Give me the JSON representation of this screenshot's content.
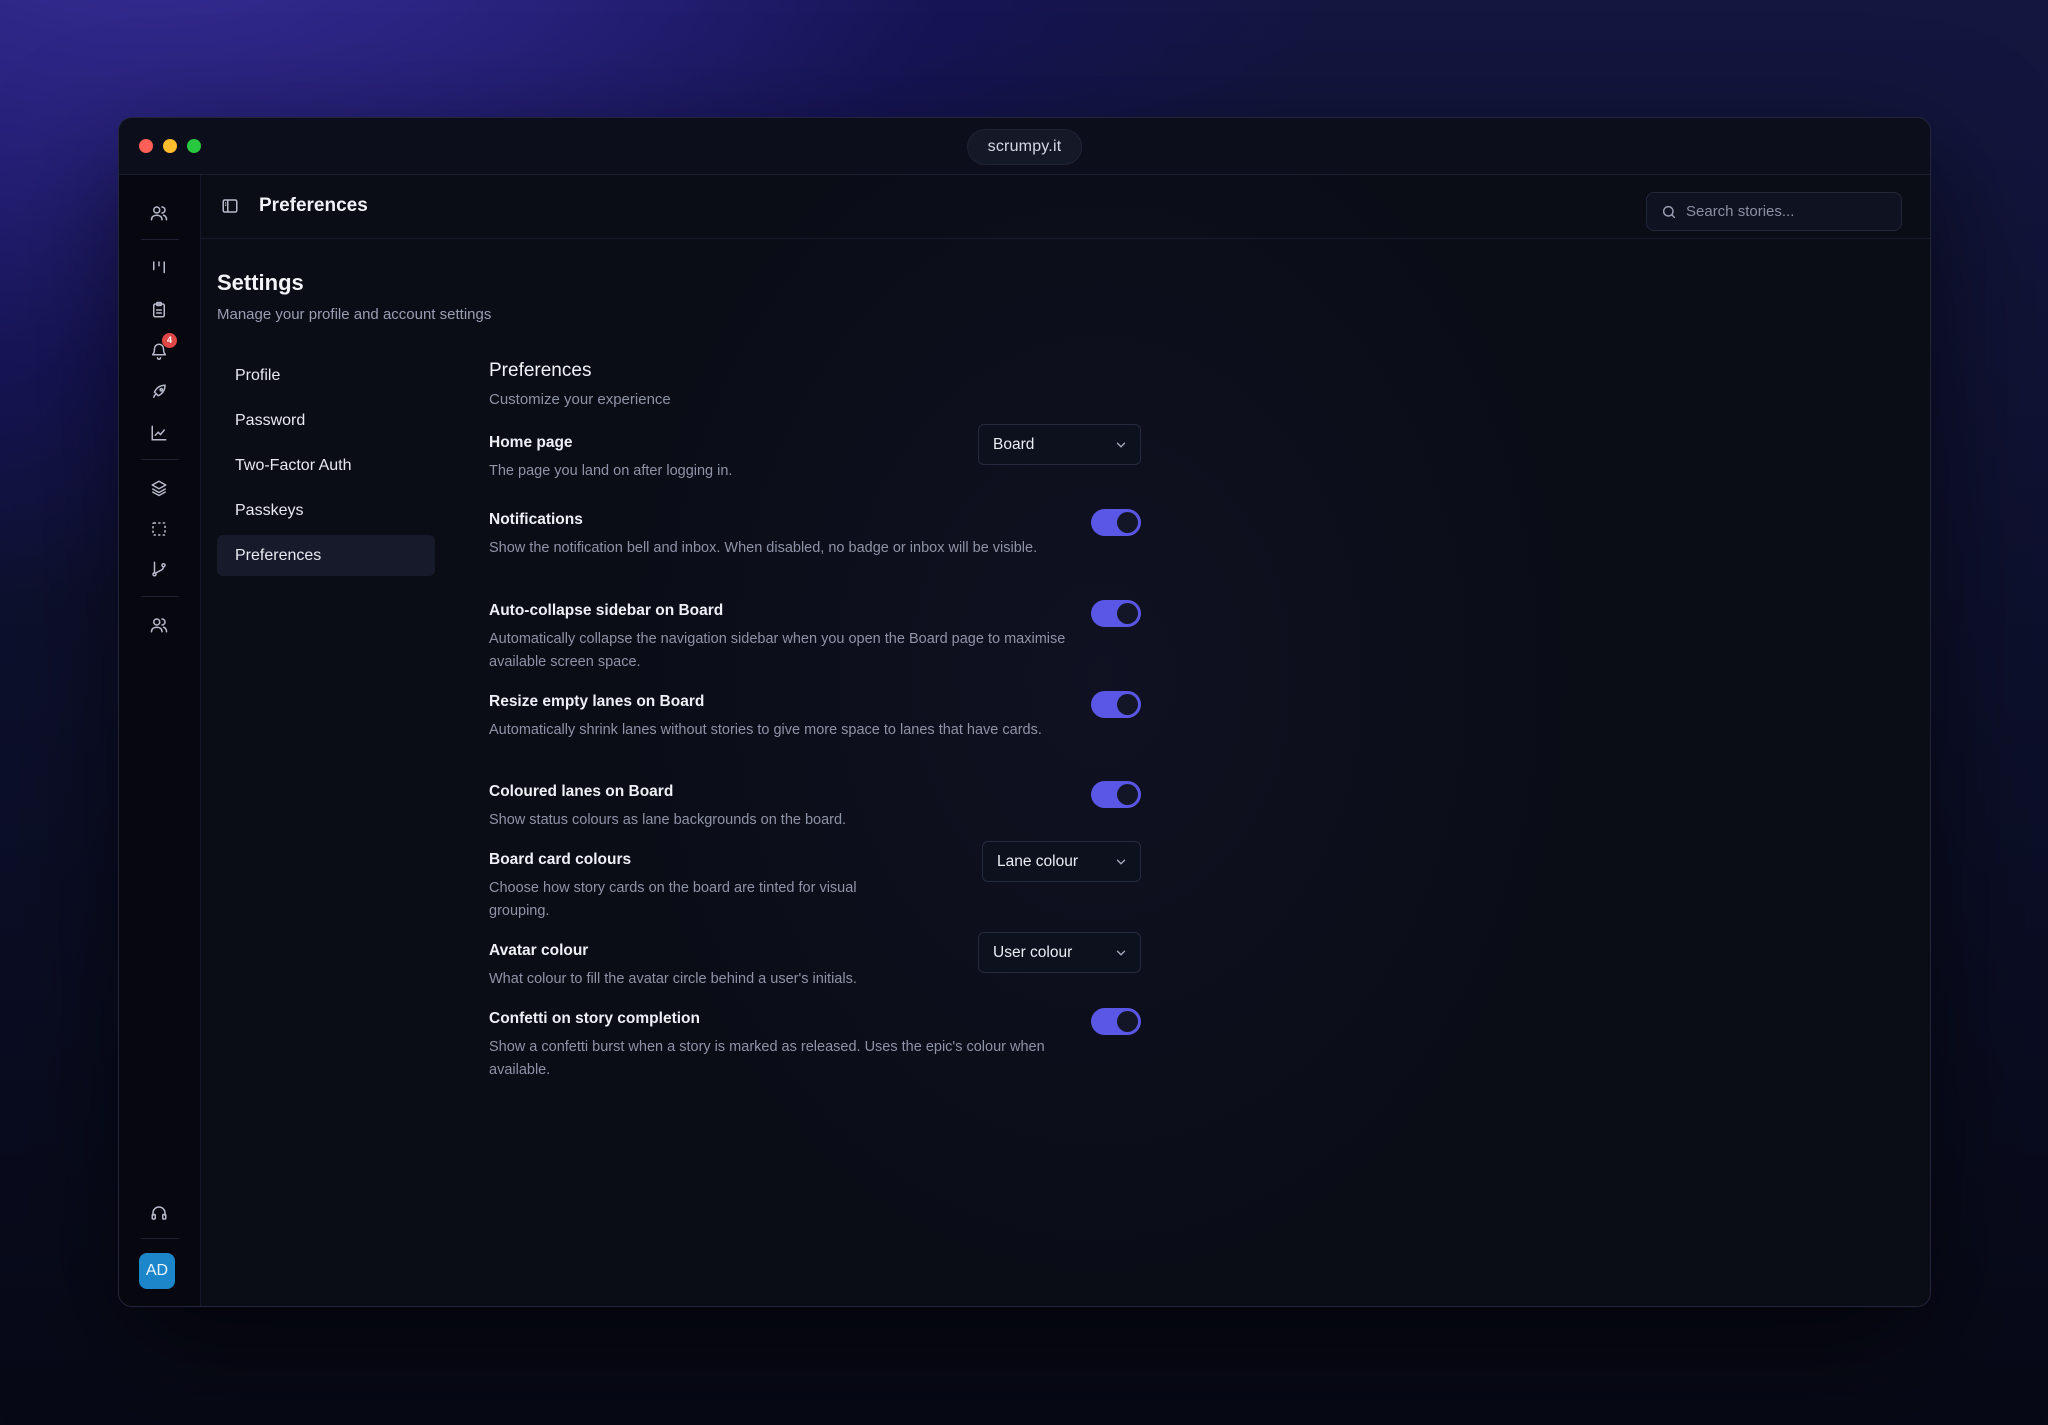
{
  "window": {
    "url": "scrumpy.it",
    "traffic_colors": [
      "#ff5f57",
      "#febc2e",
      "#28c840"
    ]
  },
  "rail": {
    "notification_count": "4",
    "avatar_initials": "AD",
    "avatar_color": "#1b86c9",
    "icons": [
      "users-icon",
      "board-icon",
      "clipboard-icon",
      "bell-icon",
      "rocket-icon",
      "chart-icon",
      "layers-icon",
      "selection-icon",
      "git-branch-icon",
      "team-icon",
      "headset-icon"
    ]
  },
  "topbar": {
    "title": "Preferences",
    "search_placeholder": "Search stories..."
  },
  "settings": {
    "title": "Settings",
    "subtitle": "Manage your profile and account settings",
    "nav": [
      {
        "label": "Profile",
        "active": false
      },
      {
        "label": "Password",
        "active": false
      },
      {
        "label": "Two-Factor Auth",
        "active": false
      },
      {
        "label": "Passkeys",
        "active": false
      },
      {
        "label": "Preferences",
        "active": true
      }
    ]
  },
  "preferences": {
    "title": "Preferences",
    "subtitle": "Customize your experience",
    "accent_color": "#5b57e6",
    "rows": [
      {
        "label": "Home page",
        "desc": "The page you land on after logging in.",
        "control": "select",
        "value": "Board"
      },
      {
        "label": "Notifications",
        "desc": "Show the notification bell and inbox. When disabled, no badge or inbox will be visible.",
        "control": "toggle",
        "on": true
      },
      {
        "label": "Auto-collapse sidebar on Board",
        "desc": "Automatically collapse the navigation sidebar when you open the Board page to maximise available screen space.",
        "control": "toggle",
        "on": true
      },
      {
        "label": "Resize empty lanes on Board",
        "desc": "Automatically shrink lanes without stories to give more space to lanes that have cards.",
        "control": "toggle",
        "on": true
      },
      {
        "label": "Coloured lanes on Board",
        "desc": "Show status colours as lane backgrounds on the board.",
        "control": "toggle",
        "on": true
      },
      {
        "label": "Board card colours",
        "desc": "Choose how story cards on the board are tinted for visual grouping.",
        "control": "select",
        "value": "Lane colour"
      },
      {
        "label": "Avatar colour",
        "desc": "What colour to fill the avatar circle behind a user's initials.",
        "control": "select",
        "value": "User colour"
      },
      {
        "label": "Confetti on story completion",
        "desc": "Show a confetti burst when a story is marked as released. Uses the epic's colour when available.",
        "control": "toggle",
        "on": true
      }
    ]
  }
}
